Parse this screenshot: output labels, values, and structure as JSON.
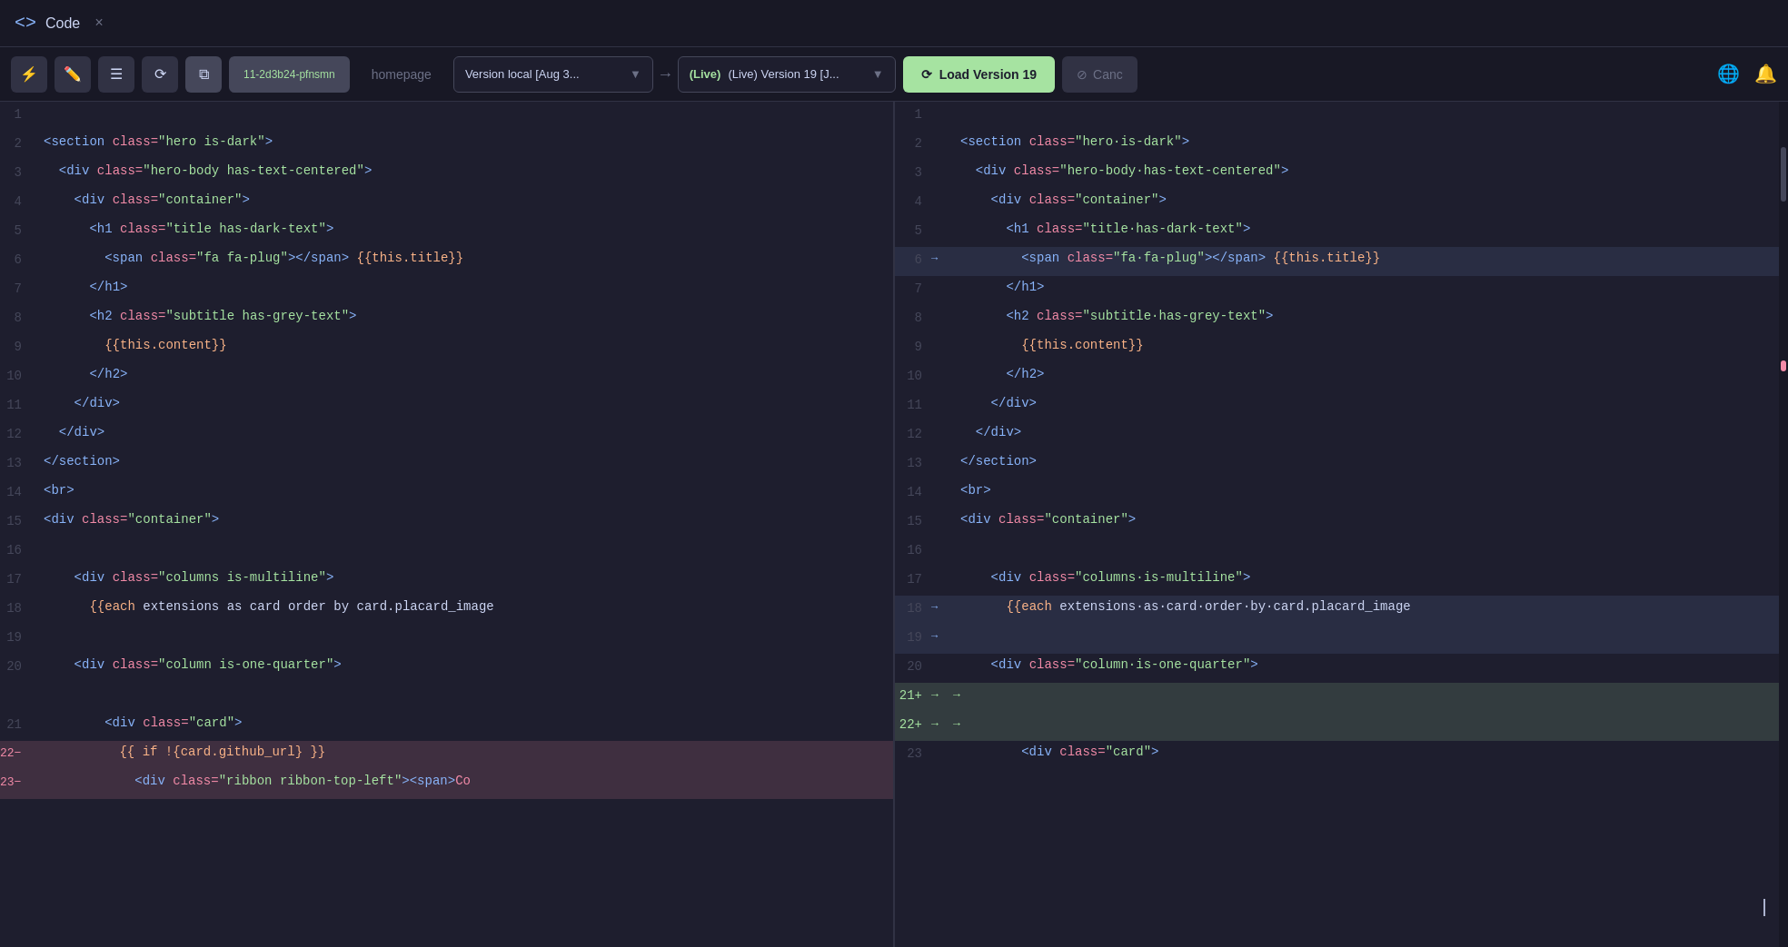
{
  "titlebar": {
    "icon": "<>",
    "title": "Code",
    "close_label": "×"
  },
  "toolbar": {
    "lightning_label": "⚡",
    "edit_label": "✎",
    "list_label": "☰",
    "history_label": "⟳",
    "copy_label": "⧉",
    "tab_name": "11-2d3b24-pfnsmn",
    "homepage_label": "homepage",
    "version_local_label": "Version local [Aug 3...",
    "arrow_label": "→",
    "version_live_label": "(Live) Version 19 [J...",
    "load_btn_label": "Load Version 19",
    "cancel_btn_label": "Canc",
    "globe_label": "🌐",
    "bell_label": "🔔"
  },
  "left_panel": {
    "lines": [
      {
        "num": "1",
        "content": ""
      },
      {
        "num": "2",
        "content": "<section class=\"hero is-dark\">"
      },
      {
        "num": "3",
        "content": "  <div class=\"hero-body has-text-centered\">"
      },
      {
        "num": "4",
        "content": "    <div class=\"container\">"
      },
      {
        "num": "5",
        "content": "      <h1 class=\"title has-dark-text\">"
      },
      {
        "num": "6",
        "content": "        <span class=\"fa fa-plug\"></span> {{this.title}}"
      },
      {
        "num": "7",
        "content": "      </h1>"
      },
      {
        "num": "8",
        "content": "      <h2 class=\"subtitle has-grey-text\">"
      },
      {
        "num": "9",
        "content": "        {{this.content}}"
      },
      {
        "num": "10",
        "content": "      </h2>"
      },
      {
        "num": "11",
        "content": "    </div>"
      },
      {
        "num": "12",
        "content": "  </div>"
      },
      {
        "num": "13",
        "content": "</section>"
      },
      {
        "num": "14",
        "content": "<br>"
      },
      {
        "num": "15",
        "content": "<div class=\"container\">"
      },
      {
        "num": "16",
        "content": ""
      },
      {
        "num": "17",
        "content": "    <div class=\"columns is-multiline\">"
      },
      {
        "num": "18",
        "content": "      {{each extensions as card order by card.placard_image"
      },
      {
        "num": "19",
        "content": ""
      },
      {
        "num": "20",
        "content": "    <div class=\"column is-one-quarter\">"
      },
      {
        "num": "21",
        "content": "        <div class=\"card\">"
      },
      {
        "num": "22",
        "content": "          {{ if !{card.github_url} }}",
        "type": "deleted"
      },
      {
        "num": "23",
        "content": "            <div class=\"ribbon ribbon-top-left\"><span>Co",
        "type": "deleted"
      }
    ]
  },
  "right_panel": {
    "lines": [
      {
        "num": "1",
        "content": ""
      },
      {
        "num": "2",
        "content": "<section class=\"hero is-dark\">",
        "marker": ""
      },
      {
        "num": "3",
        "content": "  <div class=\"hero-body has-text-centered\">",
        "marker": ""
      },
      {
        "num": "4",
        "content": "    <div class=\"container\">",
        "marker": ""
      },
      {
        "num": "5",
        "content": "      <h1 class=\"title has-dark-text\">",
        "marker": ""
      },
      {
        "num": "6",
        "content": "        <span class=\"fa fa-plug\"></span> {{this.title}}",
        "marker": "→"
      },
      {
        "num": "7",
        "content": "      </h1>",
        "marker": ""
      },
      {
        "num": "8",
        "content": "      <h2 class=\"subtitle has-grey-text\">",
        "marker": ""
      },
      {
        "num": "9",
        "content": "        {{this.content}}",
        "marker": ""
      },
      {
        "num": "10",
        "content": "      </h2>",
        "marker": ""
      },
      {
        "num": "11",
        "content": "    </div>",
        "marker": ""
      },
      {
        "num": "12",
        "content": "  </div>",
        "marker": ""
      },
      {
        "num": "13",
        "content": "</section>",
        "marker": ""
      },
      {
        "num": "14",
        "content": "<br>",
        "marker": ""
      },
      {
        "num": "15",
        "content": "<div class=\"container\">",
        "marker": ""
      },
      {
        "num": "16",
        "content": "",
        "marker": ""
      },
      {
        "num": "17",
        "content": "    <div class=\"columns is-multiline\">",
        "marker": ""
      },
      {
        "num": "18",
        "content": "      {{each extensions as card order by card.placard_image",
        "marker": "→"
      },
      {
        "num": "19",
        "content": "",
        "marker": "→"
      },
      {
        "num": "20",
        "content": "    <div class=\"column is-one-quarter\">",
        "marker": ""
      },
      {
        "num": "21+",
        "content": "",
        "marker": "+",
        "type": "added"
      },
      {
        "num": "22+",
        "content": "",
        "marker": "+",
        "type": "added"
      },
      {
        "num": "23",
        "content": "        <div class=\"card\">",
        "marker": ""
      }
    ]
  },
  "colors": {
    "bg": "#1e1e2e",
    "titlebar": "#181825",
    "toolbar": "#181825",
    "accent_blue": "#89b4fa",
    "accent_green": "#a6e3a1",
    "accent_red": "#f38ba8",
    "deleted_bg": "rgba(243,139,168,0.15)",
    "added_bg": "rgba(166,227,161,0.15)"
  }
}
